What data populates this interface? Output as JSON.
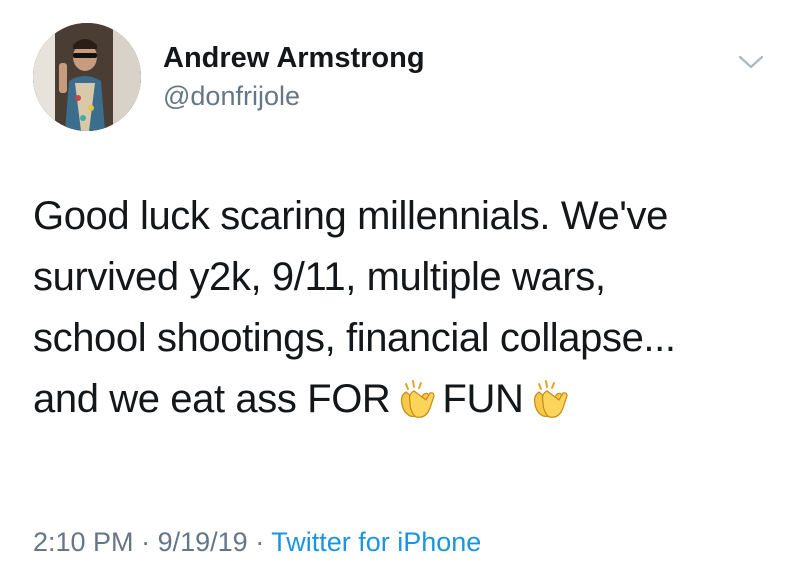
{
  "user": {
    "display_name": "Andrew Armstrong",
    "handle": "@donfrijole"
  },
  "tweet": {
    "lines": [
      "Good luck scaring millennials. We've",
      "survived y2k, 9/11, multiple wars,",
      "school shootings, financial collapse...",
      "and we eat ass FOR"
    ],
    "last_line_word": "FUN",
    "emoji": "clapping-hands"
  },
  "meta": {
    "time": "2:10 PM",
    "separator": "·",
    "date": "9/19/19",
    "source": "Twitter for iPhone"
  },
  "colors": {
    "text": "#14171a",
    "secondary": "#657786",
    "link": "#1b95e0"
  }
}
